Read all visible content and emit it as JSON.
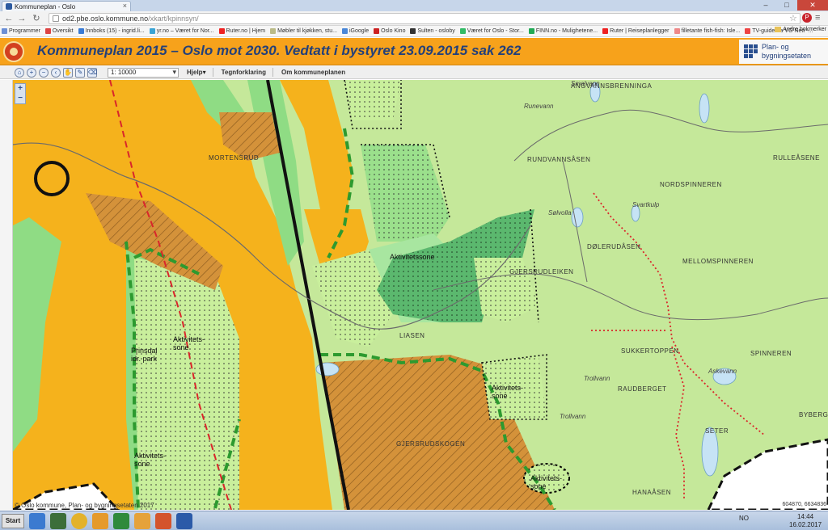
{
  "browser": {
    "tab_title": "Kommuneplan - Oslo",
    "url_host": "od2.pbe.oslo.kommune.no",
    "url_path": "/xkart/kpinnsyn/",
    "bookmarks": [
      "Programmer",
      "Oversikt",
      "Innboks (15) - ingrid.li...",
      "yr.no – Været for Nor...",
      "Ruter.no | Hjem",
      "Møbler til kjøkken, stu...",
      "iGoogle",
      "Oslo Kino",
      "Sulten - osloby",
      "Været for Oslo - Stor...",
      "FINN.no - Mulighetene...",
      "Ruter | Reiseplanlegger",
      "filletante fish-fish: Isle...",
      "TV-guide fra VG Nett -..."
    ],
    "bookmarks_right": "Andre bokmerker"
  },
  "header": {
    "title": "Kommuneplan 2015 – Oslo mot 2030. Vedtatt i bystyret 23.09.2015 sak 262",
    "agency_line1": "Plan- og",
    "agency_line2": "bygningsetaten"
  },
  "toolbar": {
    "scale_value": "1: 10000",
    "links": [
      "Hjelp",
      "Tegnforklaring",
      "Om kommuneplanen"
    ]
  },
  "map": {
    "place_labels": {
      "angvann": "ANGVANNSBRENNINGA",
      "smalvann": "Smalvann",
      "runevann": "Runevann",
      "rundvann": "RUNDVANNSÅSEN",
      "rullea": "RULLEÅSENE",
      "nordspinn": "NORDSPINNEREN",
      "dolerud": "DØLERUDÅSEN",
      "mellomspinn": "MELLOMSPINNEREN",
      "gjersrud": "GJERSRUDLEIKEN",
      "liasen": "LIASEN",
      "sukkertoppen": "SUKKERTOPPEN",
      "spinneren": "SPINNEREN",
      "raudberget": "RAUDBERGET",
      "byberg": "BYBERG",
      "seter": "SETER",
      "hanaasen": "HANAÅSEN",
      "gjersrudbakken": "GJERSRUDSKOGEN",
      "morsetrud": "MORTENSRUD",
      "solvolla": "Sølvolla",
      "svartkulp": "Svartkulp",
      "trollvann": "Trollvann",
      "askevann": "Askevann",
      "skytebane": "Skytebanen",
      "prinsdal": "Prinsdal idr. park"
    },
    "zones": [
      "Aktivitetssone",
      "Aktivitets-sone",
      "Aktivitets-sone",
      "Aktivitets-sone",
      "Aktivitets-sone"
    ],
    "colors": {
      "base_green": "#c5e89a",
      "mid_green": "#8fdc84",
      "dark_green": "#55b56b",
      "orange": "#f5b21c",
      "brown_hatch": "#c8832e",
      "road_red": "#d9262b"
    },
    "copyright": "© Oslo kommune, Plan- og bygningsetaten 2017",
    "coordinates": "604870, 6634836"
  },
  "taskbar": {
    "start_label": "Start",
    "lang": "NO",
    "time": "14:44",
    "date": "16.02.2017"
  }
}
